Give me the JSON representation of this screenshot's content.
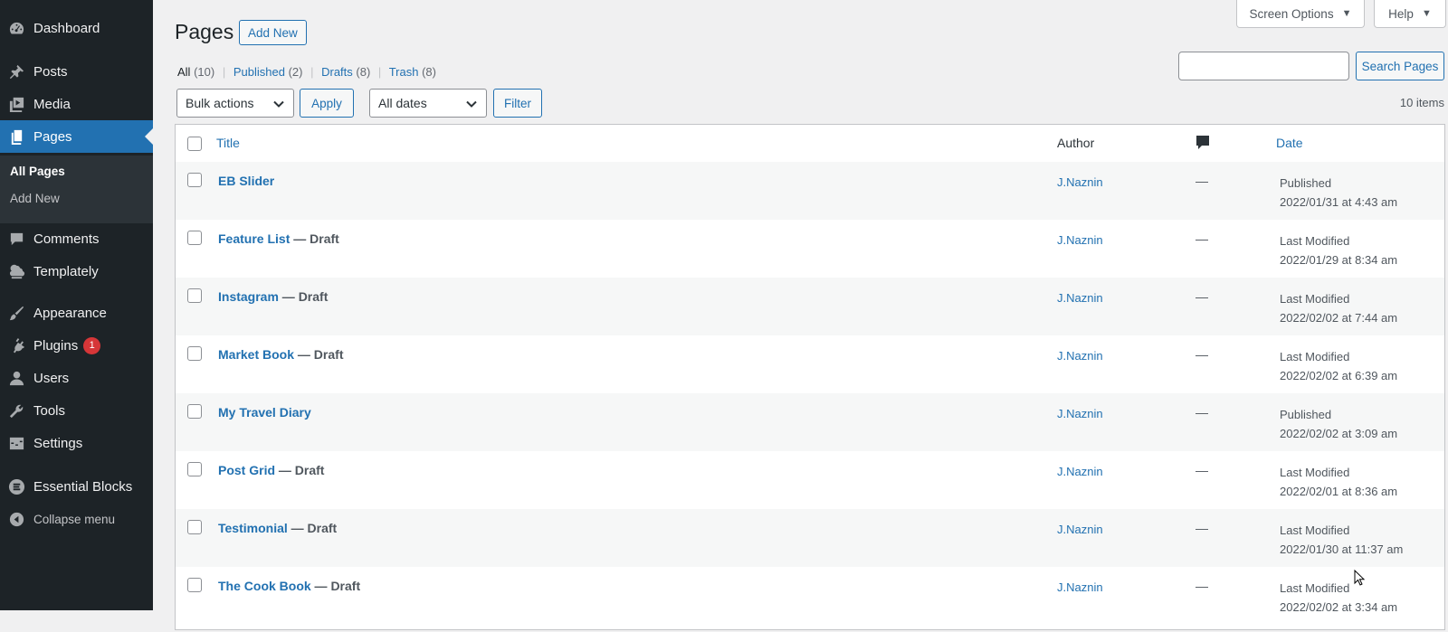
{
  "sidebar": {
    "items": [
      {
        "label": "Dashboard",
        "icon": "dashboard-icon"
      },
      {
        "label": "Posts",
        "icon": "pin-icon"
      },
      {
        "label": "Media",
        "icon": "media-icon"
      },
      {
        "label": "Pages",
        "icon": "pages-icon"
      },
      {
        "label": "Comments",
        "icon": "comment-icon"
      },
      {
        "label": "Templately",
        "icon": "templately-icon"
      },
      {
        "label": "Appearance",
        "icon": "brush-icon"
      },
      {
        "label": "Plugins",
        "icon": "plugin-icon",
        "badge": "1"
      },
      {
        "label": "Users",
        "icon": "user-icon"
      },
      {
        "label": "Tools",
        "icon": "wrench-icon"
      },
      {
        "label": "Settings",
        "icon": "settings-icon"
      },
      {
        "label": "Essential Blocks",
        "icon": "essential-blocks-icon"
      }
    ],
    "submenu": {
      "all_pages": "All Pages",
      "add_new": "Add New"
    },
    "collapse_label": "Collapse menu"
  },
  "top": {
    "screen_options": "Screen Options",
    "help": "Help"
  },
  "header": {
    "title": "Pages",
    "add_new": "Add New"
  },
  "status_links": {
    "all": "All",
    "all_count": "(10)",
    "published": "Published",
    "published_count": "(2)",
    "drafts": "Drafts",
    "drafts_count": "(8)",
    "trash": "Trash",
    "trash_count": "(8)",
    "separator": "|"
  },
  "search": {
    "value": "",
    "button": "Search Pages"
  },
  "filters": {
    "bulk_actions": "Bulk actions",
    "apply": "Apply",
    "all_dates": "All dates",
    "filter": "Filter"
  },
  "item_count": "10 items",
  "table": {
    "columns": {
      "title": "Title",
      "author": "Author",
      "date": "Date"
    },
    "rows": [
      {
        "title": "EB Slider",
        "state": "",
        "author": "J.Naznin",
        "comments": "—",
        "status": "Published",
        "date": "2022/01/31 at 4:43 am"
      },
      {
        "title": "Feature List",
        "state": " — Draft",
        "author": "J.Naznin",
        "comments": "—",
        "status": "Last Modified",
        "date": "2022/01/29 at 8:34 am"
      },
      {
        "title": "Instagram",
        "state": " — Draft",
        "author": "J.Naznin",
        "comments": "—",
        "status": "Last Modified",
        "date": "2022/02/02 at 7:44 am"
      },
      {
        "title": "Market Book",
        "state": " — Draft",
        "author": "J.Naznin",
        "comments": "—",
        "status": "Last Modified",
        "date": "2022/02/02 at 6:39 am"
      },
      {
        "title": "My Travel Diary",
        "state": "",
        "author": "J.Naznin",
        "comments": "—",
        "status": "Published",
        "date": "2022/02/02 at 3:09 am"
      },
      {
        "title": "Post Grid",
        "state": " — Draft",
        "author": "J.Naznin",
        "comments": "—",
        "status": "Last Modified",
        "date": "2022/02/01 at 8:36 am"
      },
      {
        "title": "Testimonial",
        "state": " — Draft",
        "author": "J.Naznin",
        "comments": "—",
        "status": "Last Modified",
        "date": "2022/01/30 at 11:37 am"
      },
      {
        "title": "The Cook Book",
        "state": " — Draft",
        "author": "J.Naznin",
        "comments": "—",
        "status": "Last Modified",
        "date": "2022/02/02 at 3:34 am"
      }
    ]
  },
  "colors": {
    "sidebar_bg": "#1d2327",
    "accent": "#2271b1",
    "badge": "#d63638",
    "page_bg": "#f0f0f1"
  }
}
